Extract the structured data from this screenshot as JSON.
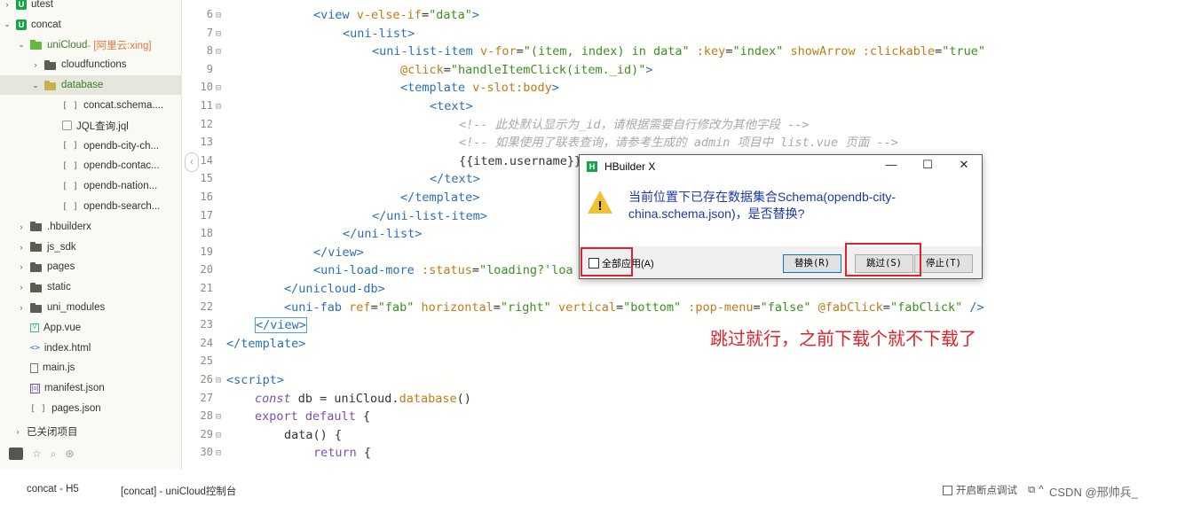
{
  "sidebar": {
    "rows": [
      {
        "label": "utest",
        "indent": 2,
        "icon": "proj",
        "chev": "›"
      },
      {
        "label": "concat",
        "indent": 2,
        "icon": "proj",
        "chev": "⌄"
      },
      {
        "label": "uniCloud",
        "sub": " - [阿里云:xing]",
        "indent": 18,
        "icon": "cloud",
        "chev": "⌄"
      },
      {
        "label": "cloudfunctions",
        "indent": 34,
        "icon": "folder",
        "chev": "›"
      },
      {
        "label": "database",
        "indent": 34,
        "icon": "folder-open",
        "chev": "⌄",
        "selected": true
      },
      {
        "label": "concat.schema....",
        "indent": 70,
        "icon": "txt",
        "glyph": "[ ]"
      },
      {
        "label": "JQL查询.jql",
        "indent": 70,
        "icon": "jql"
      },
      {
        "label": "opendb-city-ch...",
        "indent": 70,
        "icon": "txt",
        "glyph": "[ ]"
      },
      {
        "label": "opendb-contac...",
        "indent": 70,
        "icon": "txt",
        "glyph": "[ ]"
      },
      {
        "label": "opendb-nation...",
        "indent": 70,
        "icon": "txt",
        "glyph": "[ ]"
      },
      {
        "label": "opendb-search...",
        "indent": 70,
        "icon": "txt",
        "glyph": "[ ]"
      },
      {
        "label": ".hbuilderx",
        "indent": 18,
        "icon": "folder",
        "chev": "›"
      },
      {
        "label": "js_sdk",
        "indent": 18,
        "icon": "folder",
        "chev": "›"
      },
      {
        "label": "pages",
        "indent": 18,
        "icon": "folder",
        "chev": "›"
      },
      {
        "label": "static",
        "indent": 18,
        "icon": "folder",
        "chev": "›"
      },
      {
        "label": "uni_modules",
        "indent": 18,
        "icon": "folder",
        "chev": "›"
      },
      {
        "label": "App.vue",
        "indent": 34,
        "icon": "vue"
      },
      {
        "label": "index.html",
        "indent": 34,
        "icon": "html",
        "glyph": "<>"
      },
      {
        "label": "main.js",
        "indent": 34,
        "icon": "js"
      },
      {
        "label": "manifest.json",
        "indent": 34,
        "icon": "mani",
        "glyph": "[o]"
      },
      {
        "label": "pages.json",
        "indent": 34,
        "icon": "txt",
        "glyph": "[ ]"
      }
    ],
    "closed_projects": "已关闭项目"
  },
  "editor": {
    "lines": [
      {
        "num": "6",
        "fold": true
      },
      {
        "num": "7",
        "fold": true
      },
      {
        "num": "8",
        "fold": true
      },
      {
        "num": "9",
        "fold": false
      },
      {
        "num": "10",
        "fold": true
      },
      {
        "num": "11",
        "fold": true
      },
      {
        "num": "12",
        "fold": false
      },
      {
        "num": "13",
        "fold": false
      },
      {
        "num": "14",
        "fold": false
      },
      {
        "num": "15",
        "fold": false
      },
      {
        "num": "16",
        "fold": false
      },
      {
        "num": "17",
        "fold": false
      },
      {
        "num": "18",
        "fold": false
      },
      {
        "num": "19",
        "fold": false
      },
      {
        "num": "20",
        "fold": false
      },
      {
        "num": "21",
        "fold": false
      },
      {
        "num": "22",
        "fold": false
      },
      {
        "num": "23",
        "fold": false
      },
      {
        "num": "24",
        "fold": false
      },
      {
        "num": "25",
        "fold": false
      },
      {
        "num": "26",
        "fold": true
      },
      {
        "num": "27",
        "fold": false
      },
      {
        "num": "28",
        "fold": true
      },
      {
        "num": "29",
        "fold": true
      },
      {
        "num": "30",
        "fold": true
      }
    ]
  },
  "dialog": {
    "title": "HBuilder X",
    "message": "当前位置下已存在数据集合Schema(opendb-city-china.schema.json)，是否替换?",
    "apply_all": "全部应用(A)",
    "replace": "替换(R)",
    "skip": "跳过(S)",
    "stop": "停止(T)"
  },
  "annotation": "跳过就行，之前下载个就不下载了",
  "status": {
    "left1": "concat - H5",
    "left2": "[concat] - uniCloud控制台",
    "debug": "开启断点调试",
    "watermark": "CSDN @邢帅兵_"
  }
}
